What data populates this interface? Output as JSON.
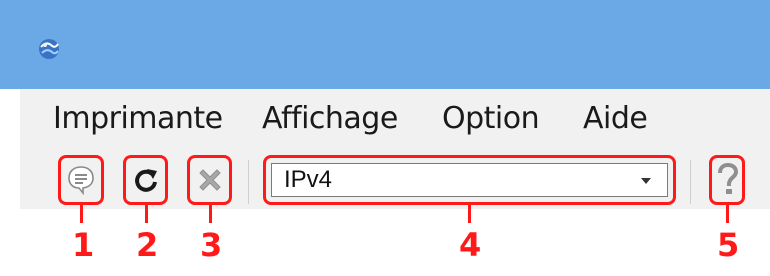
{
  "window": {
    "app_icon": "app-globe-icon",
    "titlebar_color": "#6aa8e6"
  },
  "menu": {
    "items": [
      {
        "label": "Imprimante"
      },
      {
        "label": "Affichage"
      },
      {
        "label": "Option"
      },
      {
        "label": "Aide"
      }
    ]
  },
  "toolbar": {
    "buttons": [
      {
        "icon": "settings-speech-bubble-icon"
      },
      {
        "icon": "refresh-icon"
      },
      {
        "icon": "cancel-x-icon"
      },
      {
        "icon": "help-question-icon"
      }
    ],
    "protocol_select": {
      "value": "IPv4",
      "options": [
        "IPv4"
      ]
    }
  },
  "callouts": {
    "c1": "1",
    "c2": "2",
    "c3": "3",
    "c4": "4",
    "c5": "5"
  },
  "colors": {
    "callout": "#ff1a1a",
    "toolbar_bg": "#f1f1f1"
  }
}
